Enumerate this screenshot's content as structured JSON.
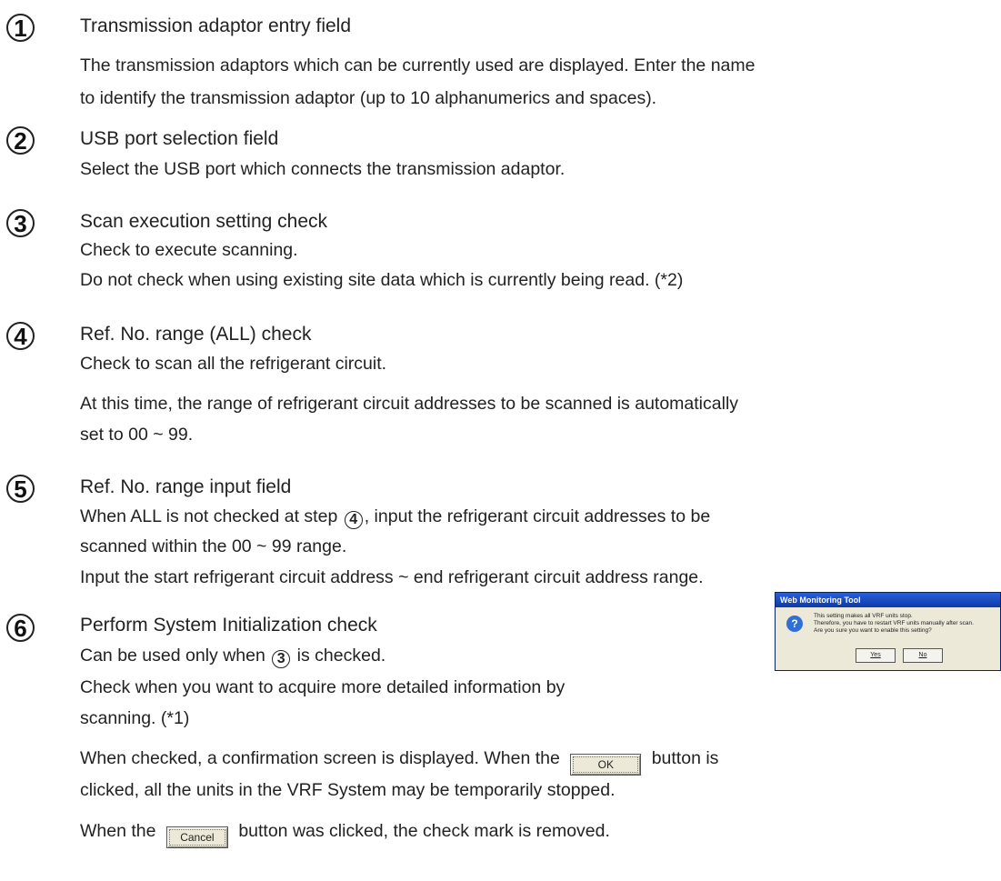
{
  "sections": [
    {
      "num": "1",
      "title": "Transmission adaptor entry field",
      "lines": [
        "The transmission adaptors which can be currently used are displayed. Enter the name",
        "to identify the transmission adaptor (up to 10 alphanumerics and spaces)."
      ]
    },
    {
      "num": "2",
      "title": "USB port selection field",
      "lines": [
        "Select the USB port which connects the transmission adaptor."
      ]
    },
    {
      "num": "3",
      "title": "Scan execution setting check",
      "lines": [
        "Check to execute scanning.",
        "Do not check when using existing site data which is currently being read. (*2)"
      ]
    },
    {
      "num": "4",
      "title": "Ref. No. range (ALL) check",
      "lines": [
        "Check to scan all the refrigerant circuit.",
        "At this time, the range of refrigerant circuit addresses to be scanned is automatically",
        "set to 00 ~ 99."
      ]
    },
    {
      "num": "5",
      "title": "Ref. No. range input field",
      "line1_pre": "When ALL is not checked at step",
      "line1_ref": "4",
      "line1_post": ", input the refrigerant circuit addresses to be",
      "line2": "scanned within the 00 ~ 99 range.",
      "line3": "Input the start refrigerant circuit address ~ end refrigerant circuit address range."
    },
    {
      "num": "6",
      "title": "Perform System Initialization check",
      "line1_pre": "Can be used only when",
      "line1_ref": "3",
      "line1_post": "is checked.",
      "line2": "Check when you want to acquire more detailed information by",
      "line3": "scanning. (*1)",
      "line4_pre": "When checked, a confirmation screen is displayed. When the",
      "line4_post": "button is",
      "line5": "clicked, all the units in the VRF System may be temporarily stopped.",
      "line6_pre": "When the",
      "line6_post": "button was clicked, the check mark is removed."
    }
  ],
  "buttons": {
    "ok": "OK",
    "cancel": "Cancel"
  },
  "dialog": {
    "title": "Web Monitoring Tool",
    "icon": "?",
    "message": [
      "This setting makes all VRF units stop.",
      "Therefore, you have to restart VRF units manually after scan.",
      "Are you sure you want to enable this setting?"
    ],
    "yes": "Yes",
    "no": "No"
  }
}
